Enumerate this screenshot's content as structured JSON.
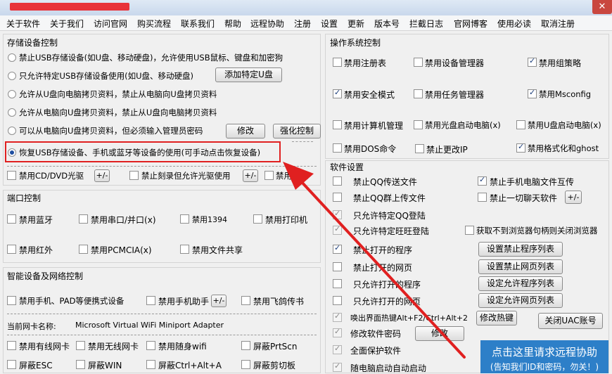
{
  "menu": [
    "关于软件",
    "关于我们",
    "访问官网",
    "购买流程",
    "联系我们",
    "帮助",
    "远程协助",
    "注册",
    "设置",
    "更新",
    "版本号",
    "拦截日志",
    "官网博客",
    "使用必读",
    "取消注册"
  ],
  "usb": {
    "title": "存储设备控制",
    "options": [
      "禁止USB存储设备(如U盘、移动硬盘)，允许使用USB鼠标、键盘和加密狗",
      "只允许特定USB存储设备使用(如U盘、移动硬盘)",
      "允许从U盘向电脑拷贝资料，禁止从电脑向U盘拷贝资料",
      "允许从电脑向U盘拷贝资料，禁止从U盘向电脑拷贝资料",
      "可以从电脑向U盘拷贝资料，但必须输入管理员密码",
      "恢复USB存储设备、手机或蓝牙等设备的使用(可手动点击恢复设备)"
    ],
    "add_usb": "添加特定U盘",
    "modify": "修改",
    "enhance": "强化控制",
    "cd_disable": "禁用CD/DVD光驱",
    "cd_burn": "禁止刻录但允许光驱使用",
    "floppy": "禁用软驱",
    "pm": "+/-"
  },
  "port": {
    "title": "端口控制",
    "items": [
      "禁用蓝牙",
      "禁用串口/并口(x)",
      "禁用1394",
      "禁用打印机",
      "禁用红外",
      "禁用PCMCIA(x)",
      "禁用文件共享"
    ]
  },
  "smart": {
    "title": "智能设备及网络控制",
    "mobile": "禁用手机、PAD等便携式设备",
    "assistant": "禁用手机助手",
    "feige": "禁用飞鸽传书",
    "nic_label": "当前网卡名称:",
    "nic_value": "Microsoft Virtual WiFi Miniport Adapter",
    "row1": [
      "禁用有线网卡",
      "禁用无线网卡",
      "禁用随身wifi",
      "屏蔽PrtScn"
    ],
    "row2": [
      "屏蔽ESC",
      "屏蔽WIN",
      "屏蔽Ctrl+Alt+A",
      "屏蔽剪切板"
    ]
  },
  "os": {
    "title": "操作系统控制",
    "items": [
      "禁用注册表",
      "禁用设备管理器",
      "禁用组策略",
      "禁用安全模式",
      "禁用任务管理器",
      "禁用Msconfig",
      "禁用计算机管理",
      "禁用光盘启动电脑(x)",
      "禁用U盘启动电脑(x)",
      "禁用DOS命令",
      "禁止更改IP",
      "禁用格式化和ghost"
    ]
  },
  "soft": {
    "title": "软件设置",
    "qq_send": "禁止QQ传送文件",
    "phone_file": "禁止手机电脑文件互传",
    "qq_group": "禁止QQ群上传文件",
    "all_chat": "禁止一切聊天软件",
    "qq_login": "只允许特定QQ登陆",
    "ww_login": "只允许特定旺旺登陆",
    "browser_close": "获取不到浏览器句柄则关闭浏览器",
    "ban_prog": "禁止打开的程序",
    "ban_web": "禁止打开的网页",
    "allow_prog": "只允许打开的程序",
    "allow_web": "只允许打开的网页",
    "btn_ban_prog": "设置禁止程序列表",
    "btn_ban_web": "设置禁止网页列表",
    "btn_allow_prog": "设定允许程序列表",
    "btn_allow_web": "设定允许网页列表",
    "hotkey": "唤出界面热键Alt+F2/Ctrl+Alt+2",
    "btn_hotkey": "修改热键",
    "btn_uac": "关闭UAC账号",
    "pwd": "修改软件密码",
    "btn_modify": "修改",
    "protect": "全面保护软件",
    "autostart": "随电脑启动自动启动"
  },
  "remote": {
    "title": "点击这里请求远程协助",
    "sub": "(告知我们ID和密码，勿关！)"
  }
}
